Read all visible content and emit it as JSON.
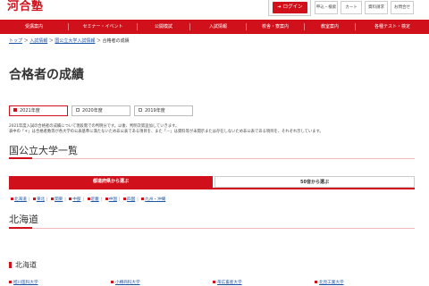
{
  "logo": "河合塾",
  "login": {
    "label": "ログイン",
    "icon": "login-icon"
  },
  "utility_links": [
    "申込・検索",
    "カート",
    "資料請求",
    "お問合せ"
  ],
  "nav": [
    "受講案内",
    "セミナー・イベント",
    "公開模試",
    "入試情報",
    "校舎・寮案内",
    "教室案内",
    "各種テスト・検定"
  ],
  "breadcrumb": [
    "トップ",
    "入試情報",
    "国公立大学入試情報",
    "合格者の成績"
  ],
  "page_title": "合格者の成績",
  "year_tabs": [
    "2021年度",
    "2020年度",
    "2019年度"
  ],
  "notes": [
    "2021年度入試の合格者の成績について現段階での判明分です。以後、判明次第追加していきます。",
    "表中の「＊」は合格者数等が各大学の公表基準に満たないため非公表である項目を、また「－」は資料等が未開示または存在しないため非公表である項目を、それぞれ示しています。"
  ],
  "section_title": "国公立大学一覧",
  "mode_tabs": [
    "都道府県から選ぶ",
    "50音から選ぶ"
  ],
  "regions": [
    "北海道",
    "東北",
    "関東",
    "中部",
    "近畿",
    "中国",
    "四国",
    "九州・沖縄"
  ],
  "region_title": "北海道",
  "sub_heading": "北海道",
  "universities": [
    "旭川医科大学",
    "小樽商科大学",
    "帯広畜産大学",
    "北見工業大学"
  ],
  "colors": {
    "brand": "#d0101b",
    "link": "#1a55a6"
  }
}
